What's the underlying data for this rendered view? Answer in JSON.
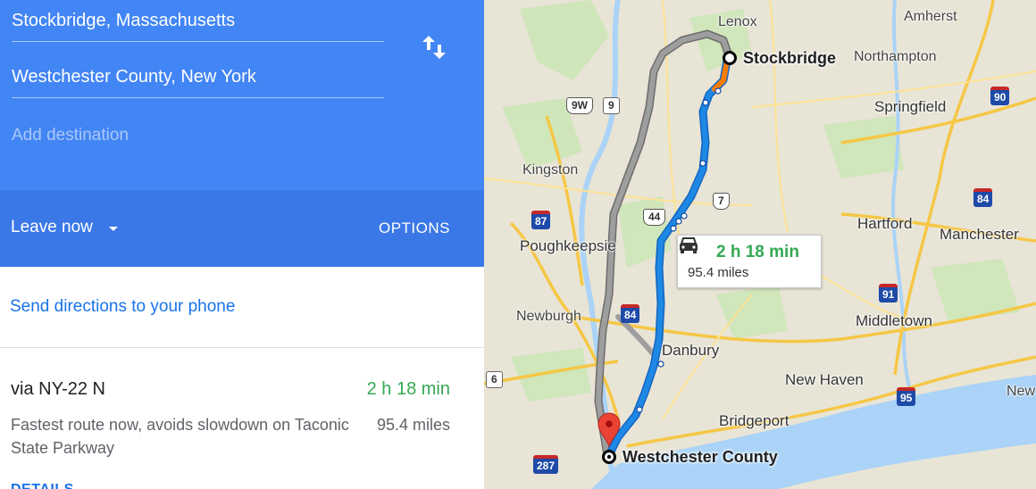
{
  "directions": {
    "start": "Stockbridge, Massachusetts",
    "destination": "Westchester County, New York",
    "add_destination_placeholder": "Add destination",
    "swap_icon": "swap-vert-icon"
  },
  "departure": {
    "leave_now_label": "Leave now",
    "options_label": "OPTIONS"
  },
  "send_to_phone_label": "Send directions to your phone",
  "route": {
    "via": "via NY-22 N",
    "time": "2 h 18 min",
    "distance": "95.4 miles",
    "description": "Fastest route now, avoids slowdown on Taconic State Parkway",
    "details_label": "DETAILS"
  },
  "map": {
    "callout": {
      "time": "2 h 18 min",
      "distance": "95.4 miles",
      "icon": "car-icon"
    },
    "origin_label": "Stockbridge",
    "destination_label": "Westchester County",
    "places": [
      "Lenox",
      "Amherst",
      "Northampton",
      "Springfield",
      "Kingston",
      "Hartford",
      "Manchester",
      "Poughkeepsie",
      "Newburgh",
      "Middletown",
      "Danbury",
      "New Haven",
      "Bridgeport",
      "New"
    ],
    "shields": {
      "i90": "90",
      "i84_east": "84",
      "i87": "87",
      "i91": "91",
      "i84_west": "84",
      "i95": "95",
      "i287": "287",
      "us9w": "9W",
      "us44": "44",
      "us7": "7",
      "st9": "9",
      "st6": "6"
    },
    "colors": {
      "route_fast": "#1e88e5",
      "route_alt": "#8e8e8e",
      "traffic_slow": "#f57c00",
      "land": "#e8e4d6",
      "water": "#aad3f7",
      "park": "#cde6b8",
      "panel_header": "#4285f4"
    }
  }
}
